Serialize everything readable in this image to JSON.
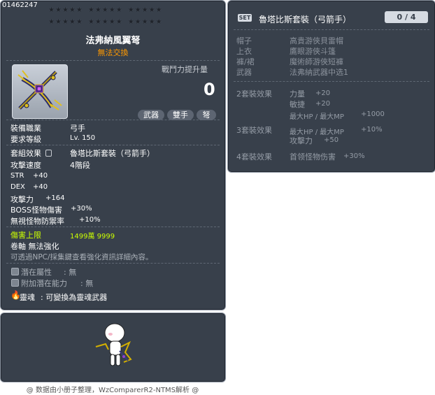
{
  "item": {
    "id": "01462247",
    "name": "法弗納風翼弩",
    "trade_note": "無法交換",
    "combat": {
      "label": "戰鬥力提升量",
      "value": "0"
    },
    "tags": [
      "武器",
      "雙手",
      "弩"
    ],
    "req_job_label": "裝備職業",
    "req_job_value": "弓手",
    "req_level_label": "要求等級",
    "req_level_value": "Lv. 150",
    "set_label": "套組效果",
    "set_value": "魯塔比斯套裝（弓箭手）",
    "speed_label": "攻擊速度",
    "speed_value": "4階段",
    "stats": [
      {
        "name": "STR",
        "value": "+40"
      },
      {
        "name": "DEX",
        "value": "+40"
      },
      {
        "name": "攻擊力",
        "value": "+164"
      },
      {
        "name": "BOSS怪物傷害",
        "value": "+30%"
      },
      {
        "name": "無視怪物防禦率",
        "value": "+10%"
      }
    ],
    "damage_cap_label": "傷害上限",
    "damage_cap_value": "1499萬 9999",
    "scroll_text": "卷軸 無法強化",
    "hint": "可透過NPC/採集鍵查看強化資訊詳細內容。",
    "potential_label": "潛在屬性",
    "potential_value": ": 無",
    "bonus_potential_label": "附加潛在能力",
    "bonus_potential_value": ": 無",
    "soul_label": "靈魂",
    "soul_value": ": 可變換為靈魂武器"
  },
  "set": {
    "badge": "SET",
    "name": "魯塔比斯套裝（弓箭手）",
    "count": "0 / 4",
    "parts": [
      {
        "slot": "帽子",
        "item": "高貴游俠貝雷帽"
      },
      {
        "slot": "上衣",
        "item": "鷹眼游俠斗篷"
      },
      {
        "slot": "褲/裙",
        "item": "魔術師游俠短褲"
      },
      {
        "slot": "武器",
        "item": "法弗納武器中选1"
      }
    ],
    "effects": [
      {
        "label": "2套裝效果",
        "lines": [
          {
            "name": "力量",
            "value": "+20"
          },
          {
            "name": "敏捷",
            "value": "+20"
          },
          {
            "name": "最大HP / 最大MP",
            "value": "+1000"
          }
        ]
      },
      {
        "label": "3套裝效果",
        "lines": [
          {
            "name": "最大HP / 最大MP",
            "value": "+10%"
          },
          {
            "name": "攻擊力",
            "value": "+50"
          }
        ]
      },
      {
        "label": "4套裝效果",
        "lines": [
          {
            "name": "首领怪物伤害",
            "value": "+30%"
          }
        ]
      }
    ]
  },
  "credit": "@ 数据由小册子整理，WzComparerR2-NTMS解析 @",
  "colors": {
    "panel": "#38404b",
    "accent_orange": "#ff9900",
    "accent_green": "#ccff00"
  }
}
